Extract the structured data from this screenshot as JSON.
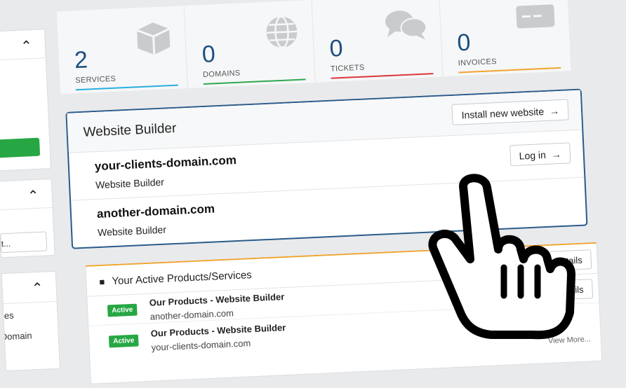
{
  "stats": [
    {
      "count": "2",
      "label": "SERVICES",
      "color": "#29aee0",
      "icon": "cube-icon"
    },
    {
      "count": "0",
      "label": "DOMAINS",
      "color": "#2fa84f",
      "icon": "globe-icon"
    },
    {
      "count": "0",
      "label": "TICKETS",
      "color": "#d9383a",
      "icon": "comments-icon"
    },
    {
      "count": "0",
      "label": "INVOICES",
      "color": "#f0a42e",
      "icon": "credit-card-icon"
    }
  ],
  "sidebar": {
    "search_value": "ct...",
    "items": [
      "ces",
      "Domain"
    ]
  },
  "website_builder": {
    "title": "Website Builder",
    "install_label": "Install new website",
    "login_label": "Log in",
    "sites": [
      {
        "domain": "your-clients-domain.com",
        "type": "Website Builder"
      },
      {
        "domain": "another-domain.com",
        "type": "Website Builder"
      }
    ]
  },
  "products": {
    "title": "Your Active Products/Services",
    "view_details": "Details",
    "view_details_2": "w Details",
    "view_more": "View More...",
    "rows": [
      {
        "status": "Active",
        "name": "Our Products - Website Builder",
        "domain": "another-domain.com"
      },
      {
        "status": "Active",
        "name": "Our Products - Website Builder",
        "domain": "your-clients-domain.com"
      }
    ]
  },
  "colors": {
    "accent": "#2a5b8a",
    "active": "#27a744",
    "warning": "#f0a42e"
  }
}
